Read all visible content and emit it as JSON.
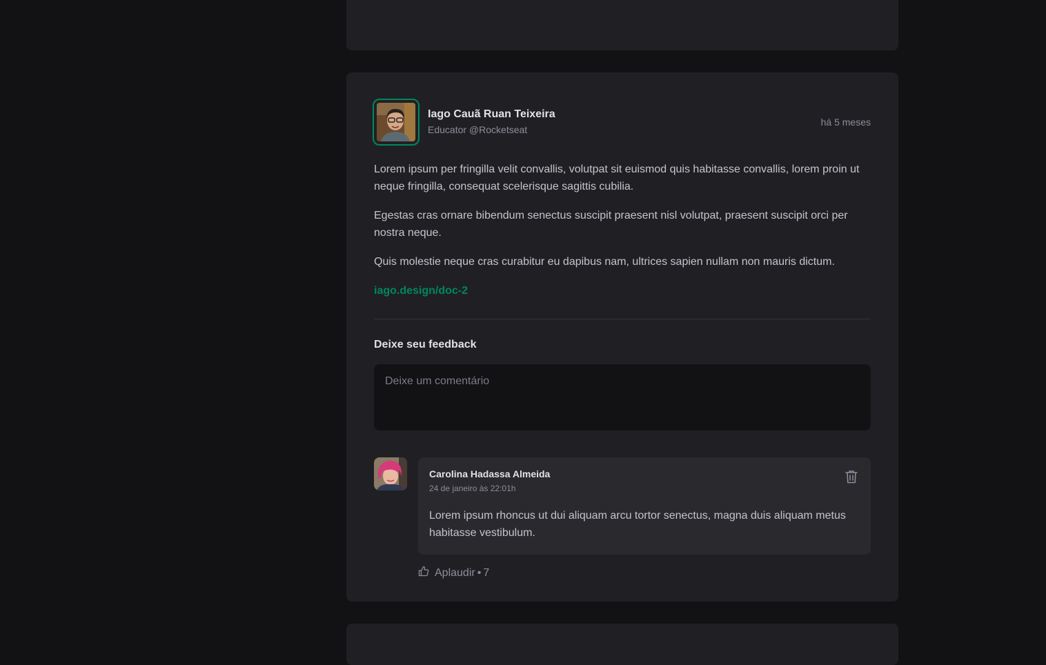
{
  "post": {
    "author_name": "Iago Cauã Ruan Teixeira",
    "author_role": "Educator @Rocketseat",
    "published": "há 5 meses",
    "paragraphs": [
      "Lorem ipsum per fringilla velit convallis, volutpat sit euismod quis habitasse convallis, lorem proin ut neque fringilla, consequat scelerisque sagittis cubilia.",
      "Egestas cras ornare bibendum senectus suscipit praesent nisl volutpat, praesent suscipit orci per nostra neque.",
      "Quis molestie neque cras curabitur eu dapibus nam, ultrices sapien nullam non mauris dictum."
    ],
    "link": "iago.design/doc-2"
  },
  "feedback": {
    "title": "Deixe seu feedback",
    "placeholder": "Deixe um comentário"
  },
  "comment": {
    "author": "Carolina Hadassa Almeida",
    "time": "24 de janeiro às 22:01h",
    "text": "Lorem ipsum rhoncus ut dui aliquam arcu tortor senectus, magna duis aliquam metus habitasse vestibulum.",
    "applaud_label": "Aplaudir",
    "applaud_separator": "•",
    "applaud_count": "7"
  },
  "colors": {
    "background": "#121214",
    "card": "#202024",
    "accent": "#00875f",
    "comment_box": "#29292e"
  },
  "icons": {
    "delete": "trash-icon",
    "applaud": "thumbs-up-icon"
  }
}
